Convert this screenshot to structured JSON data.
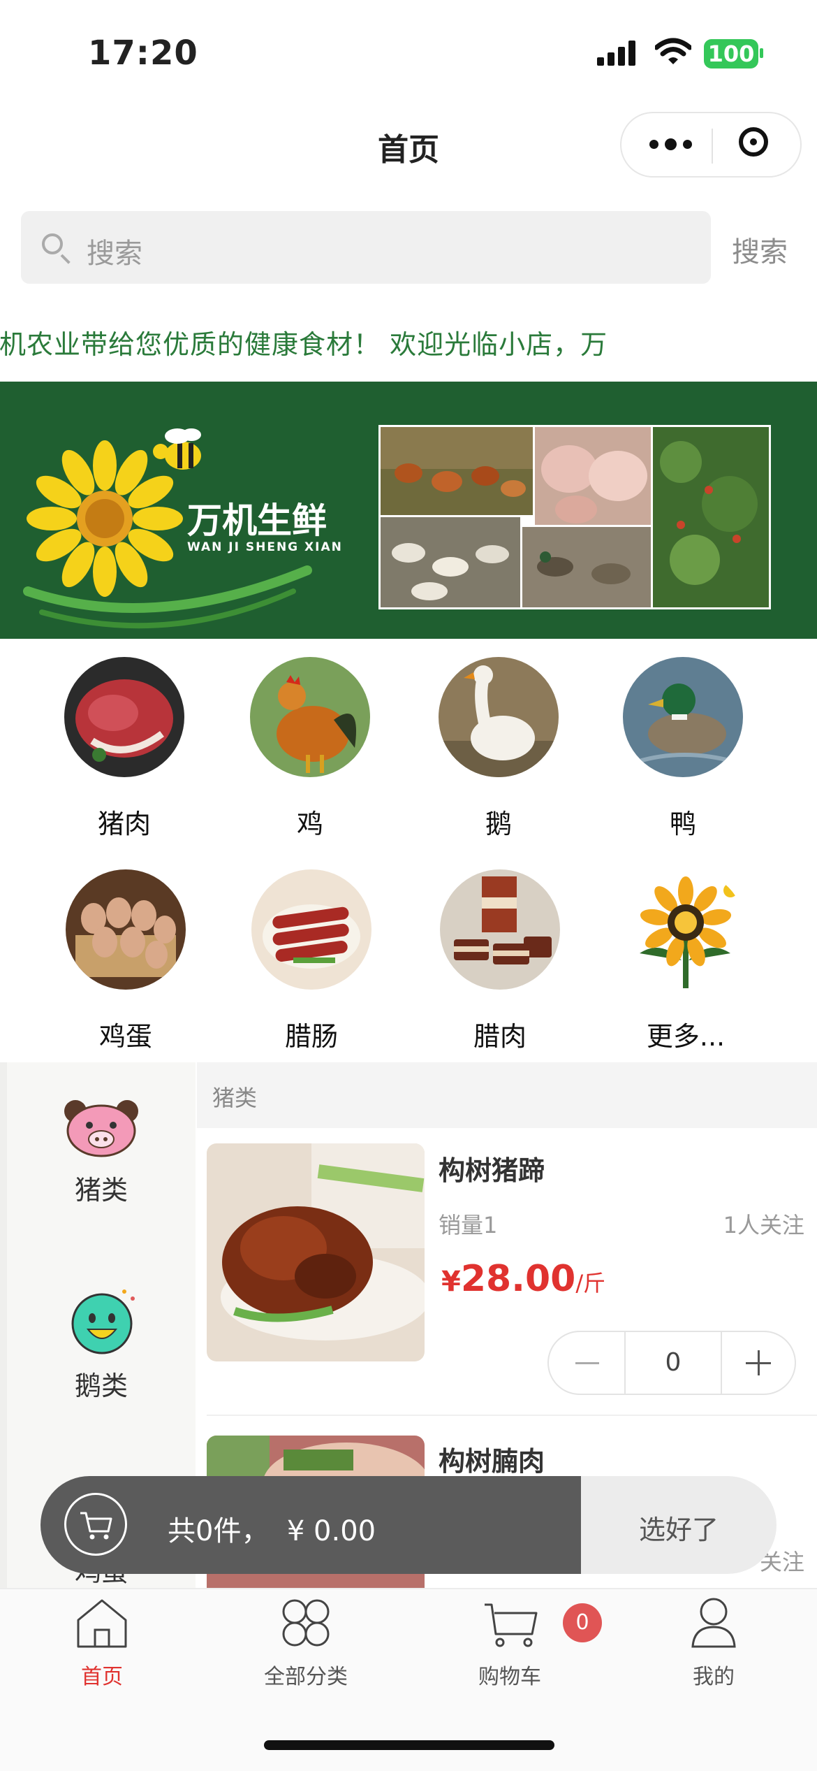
{
  "status_bar": {
    "time": "17:20",
    "battery": "100"
  },
  "nav": {
    "title": "首页"
  },
  "search": {
    "placeholder": "搜索",
    "button": "搜索"
  },
  "notice": {
    "text": "店，万机农业带给您优质的健康食材！  欢迎光临小店，万"
  },
  "banner": {
    "brand_cn": "万机生鲜",
    "brand_en": "WAN JI SHENG XIAN"
  },
  "categories": [
    {
      "label": "猪肉",
      "icon": "pork-icon"
    },
    {
      "label": "鸡",
      "icon": "chicken-icon"
    },
    {
      "label": "鹅",
      "icon": "goose-icon"
    },
    {
      "label": "鸭",
      "icon": "duck-icon"
    },
    {
      "label": "鸡蛋",
      "icon": "egg-icon"
    },
    {
      "label": "腊肠",
      "icon": "sausage-icon"
    },
    {
      "label": "腊肉",
      "icon": "bacon-icon"
    },
    {
      "label": "更多...",
      "icon": "sunflower-more-icon"
    }
  ],
  "sidebar": {
    "items": [
      {
        "label": "猪类",
        "icon": "pig-face-icon"
      },
      {
        "label": "鹅类",
        "icon": "smiley-face-icon"
      },
      {
        "label": "鸡蛋",
        "icon": "egg-category-icon"
      }
    ]
  },
  "section": {
    "title": "猪类"
  },
  "products": [
    {
      "name": "构树猪蹄",
      "sales": "销量1",
      "followers": "1人关注",
      "currency": "¥",
      "price": "28.00",
      "unit": "/斤",
      "quantity": "0"
    },
    {
      "name": "构树腩肉",
      "followers": "关注"
    }
  ],
  "cart": {
    "summary": "共0件，  ¥ 0.00",
    "submit": "选好了"
  },
  "tabbar": {
    "items": [
      {
        "label": "首页",
        "icon": "home-icon"
      },
      {
        "label": "全部分类",
        "icon": "categories-icon"
      },
      {
        "label": "购物车",
        "icon": "cart-icon"
      },
      {
        "label": "我的",
        "icon": "user-icon"
      }
    ],
    "cart_badge": "0"
  },
  "colors": {
    "accent": "#e0322f",
    "banner": "#1f5f30",
    "notice": "#2a7a3a",
    "battery": "#34c759"
  }
}
